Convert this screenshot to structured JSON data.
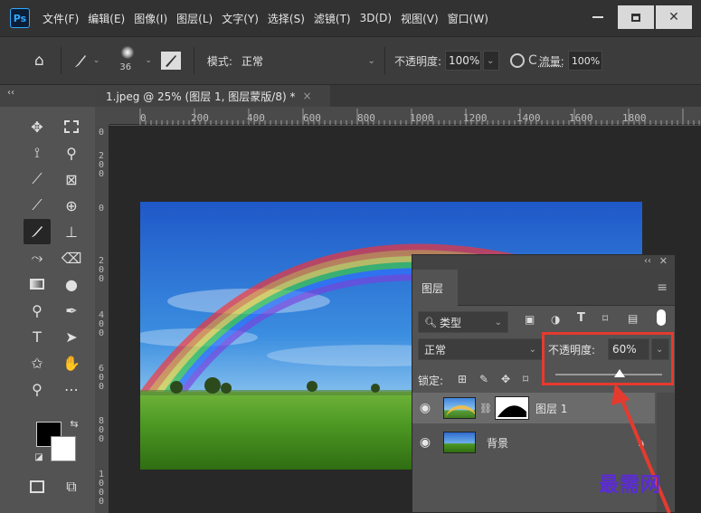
{
  "app": {
    "logo": "Ps"
  },
  "menu": [
    "文件(F)",
    "编辑(E)",
    "图像(I)",
    "图层(L)",
    "文字(Y)",
    "选择(S)",
    "滤镜(T)",
    "3D(D)",
    "视图(V)",
    "窗口(W)"
  ],
  "options_bar": {
    "brush_size": "36",
    "mode_label": "模式:",
    "mode_value": "正常",
    "opacity_label": "不透明度:",
    "opacity_value": "100%",
    "flow_label": "流量:",
    "flow_value": "100%"
  },
  "tool_panel": {
    "collapse_glyph": "‹‹"
  },
  "document_tab": {
    "title": "1.jpeg @ 25% (图层 1, 图层蒙版/8) *",
    "close": "×"
  },
  "ruler": {
    "top_ticks": [
      "0",
      "200",
      "400",
      "600",
      "800",
      "1000",
      "1200",
      "1400",
      "1600",
      "1800"
    ],
    "left_ticks": [
      [
        "0"
      ],
      [
        "2",
        "0",
        "0"
      ],
      [
        "0"
      ],
      [
        "2",
        "0",
        "0"
      ],
      [
        "4",
        "0",
        "0"
      ],
      [
        "6",
        "0",
        "0"
      ],
      [
        "8",
        "0",
        "0"
      ],
      [
        "1",
        "0",
        "0",
        "0"
      ]
    ]
  },
  "layers_panel": {
    "tab_label": "图层",
    "filter_kind": "类型",
    "blend_mode": "正常",
    "opacity_label": "不透明度:",
    "opacity_value": "60%",
    "opacity_fraction": 0.6,
    "lock_label": "锁定:",
    "layers": [
      {
        "name": "图层 1",
        "visible": true,
        "selected": true,
        "has_mask": true
      },
      {
        "name": "背景",
        "visible": true,
        "selected": false,
        "locked": true
      }
    ]
  },
  "annotation": {
    "highlight_color": "#e53a2e",
    "arrow_color": "#e53a2e"
  },
  "watermark": "最需网",
  "colors": {
    "accent": "#31a8ff",
    "foreground": "#000000",
    "background": "#ffffff"
  }
}
